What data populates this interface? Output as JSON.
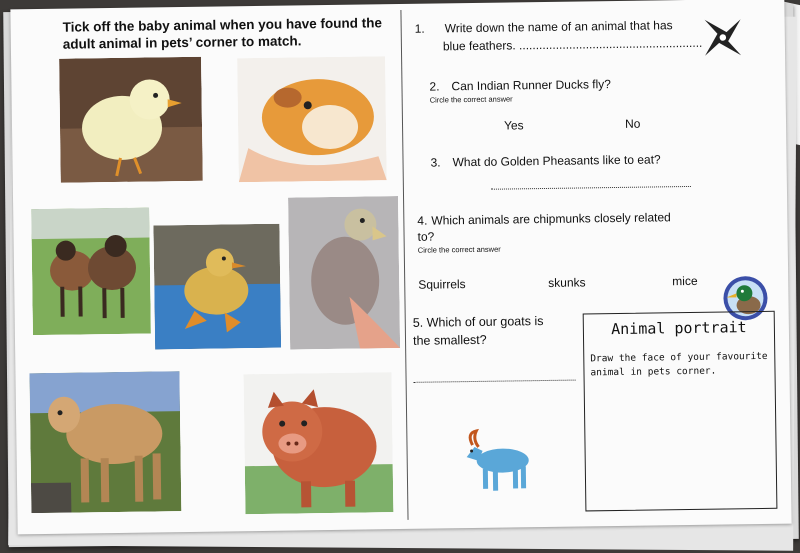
{
  "left": {
    "instruction": "Tick off the baby animal when you have found the adult animal in pets’ corner to match."
  },
  "questions": [
    {
      "number": "1.",
      "text": "Write down the name of an animal that has blue feathers.",
      "line1": "Write down the name of an animal that has",
      "line2": "blue feathers. ......................................................."
    },
    {
      "number": "2.",
      "text": "Can Indian Runner Ducks fly?",
      "hint": "Circle the correct answer",
      "options": [
        "Yes",
        "No"
      ]
    },
    {
      "number": "3.",
      "text": "What do Golden Pheasants like to eat?"
    },
    {
      "number": "4.",
      "text": "Which animals are chipmunks closely related",
      "line2": "to?",
      "hint": "Circle the correct answer",
      "options": [
        "Squirrels",
        "skunks",
        "mice"
      ]
    },
    {
      "number": "5.",
      "text": "Which of our goats is",
      "line2": "the smallest?"
    }
  ],
  "portrait": {
    "title": "Animal portrait",
    "instruction": "Draw the face of your favourite animal in pets corner."
  },
  "icons": [
    "compass-logo-icon",
    "duck-badge-icon",
    "goat-icon"
  ],
  "photos": [
    "chick",
    "guinea-pig",
    "lambs",
    "duckling",
    "baby-bird",
    "kid-goat",
    "piglet"
  ],
  "colors": {
    "paper": "#fbfbfb",
    "background": "#3d3a38",
    "goat": "#5aa7d8"
  }
}
